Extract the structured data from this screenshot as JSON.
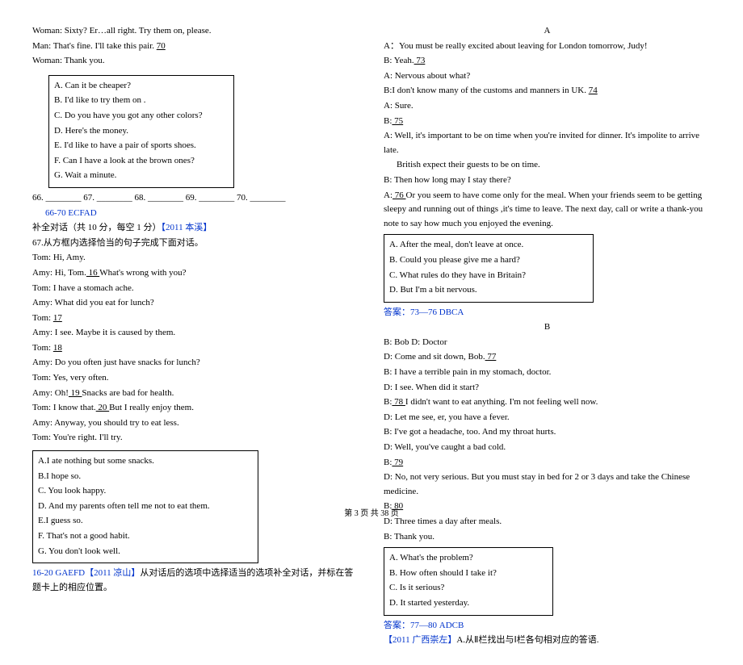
{
  "left": {
    "l1": "Woman: Sixty? Er…all right. Try them on, please.",
    "l2_pre": " Man: That's fine. I'll take this pair. ",
    "l2_blank": "   70   ",
    "l3": "Woman: Thank you.",
    "boxA": {
      "a": "A. Can it be cheaper?",
      "b": "B. I'd like to try them on .",
      "c": "C. Do you have you got any other colors?",
      "d": "D. Here's the money.",
      "e": "E. I'd like to have a pair of sports shoes.",
      "f": "F. Can I have a look at the brown ones?",
      "g": "G. Wait a minute."
    },
    "nums": "66. ________    67. ________    68. ________    69. ________    70. ________",
    "ans1_a": "66-70 ECFAD",
    "sec1_a": " 补全对话（共 10 分，每空 1 分）",
    "sec1_b": "【2011 本溪】",
    "sec1_c": "67.从方框内选择恰当的句子完成下面对话。",
    "d1": "Tom: Hi, Amy.",
    "d2a": "Amy: Hi, Tom.",
    "d2b": "   16   ",
    "d2c": " What's wrong with you?",
    "d3": "Tom: I have a stomach ache.",
    "d4": "Amy: What did you eat for lunch?",
    "d5a": "Tom: ",
    "d5b": "   17   ",
    "d6": "Amy: I see. Maybe it is caused by them.",
    "d7a": "Tom: ",
    "d7b": "   18   ",
    "d8": "Amy: Do you often just have snacks for lunch?",
    "d9": "Tom: Yes, very often.",
    "d10a": "Amy: Oh!",
    "d10b": "   19   ",
    "d10c": " Snacks are bad for health.",
    "d11a": "Tom: I know that.",
    "d11b": "   20   ",
    "d11c": " But I really enjoy them.",
    "d12": "Amy: Anyway, you should try to eat less.",
    "d13": "Tom: You're right. I'll try.",
    "boxB": {
      "a": "A.I ate nothing but some snacks.",
      "b": "B.I hope so.",
      "c": "C. You look happy.",
      "d": "D. And my parents often tell me not to eat them.",
      "e": "E.I guess so.",
      "f": "F. That's not a good habit.",
      "g": "G. You don't look well."
    },
    "ans2_a": "16-20 GAEFD",
    "ans2_b": "【2011 凉山】",
    "ans2_c": "从对话后的选项中选择适当的选项补全对话，并标在答题卡上的相应位置。"
  },
  "right": {
    "titleA": "A",
    "a1": "A：You must be really excited about leaving for London tomorrow, Judy!",
    "a2a": "B: Yeah.",
    "a2b": "   73   ",
    "a3": "A: Nervous about what?",
    "a4a": "B:I don't know many of the customs and manners in UK. ",
    "a4b": "   74   ",
    "a5": "A: Sure.",
    "a6a": "B:",
    "a6b": "   75   ",
    "a7": "A: Well, it's important to be on time when you're invited for dinner. It's impolite to arrive late.",
    "a7b": "British expect their guests to be on time.",
    "a8": "B: Then how long may I stay there?",
    "a9a": "A:",
    "a9b": "   76   ",
    "a9c": " Or you seem to have come only for the meal. When your friends seem to be getting sleepy and running out of things ,it's time to leave. The next day, call or write a thank-you note to say how much you enjoyed the evening.",
    "boxC": {
      "a": "A.   After the meal, don't leave at once.",
      "b": "B.   Could you please give me a hard?",
      "c": "C.   What rules do they have in Britain?",
      "d": "D.   But I'm a bit nervous."
    },
    "ansC": "答案：73—76 DBCA",
    "titleB": "B",
    "b0": "B: Bob                              D: Doctor",
    "b1a": "D: Come and sit down, Bob.",
    "b1b": "   77   ",
    "b2": "B: I have a terrible pain in my stomach, doctor.",
    "b3": "D: I see. When did it start?",
    "b4a": "B:",
    "b4b": "   78   ",
    "b4c": " I didn't want to eat anything. I'm not feeling well now.",
    "b5": "D: Let me see, er, you have a fever.",
    "b6": "B: I've got a headache, too. And my throat hurts.",
    "b7": "D: Well, you've caught a bad cold.",
    "b8a": "B:",
    "b8b": "   79   ",
    "b9": "D: No, not very serious. But you must stay in bed for 2 or 3 days and take the Chinese medicine.",
    "b10a": "B:",
    "b10b": "   80   ",
    "b11": "D: Three times a day after meals.",
    "b12": "B: Thank you.",
    "boxD": {
      "a": "A.   What's the problem?",
      "b": "B.   How often should I take it?",
      "c": "C.   Is it serious?",
      "d": "D.   It started yesterday."
    },
    "ansD": "答案：77—80 ADCB",
    "tail_a": "【2011 广西崇左】",
    "tail_b": "A.从Ⅱ栏找出与Ⅰ栏各句相对应的答语."
  },
  "footer": "第 3 页 共 38 页"
}
